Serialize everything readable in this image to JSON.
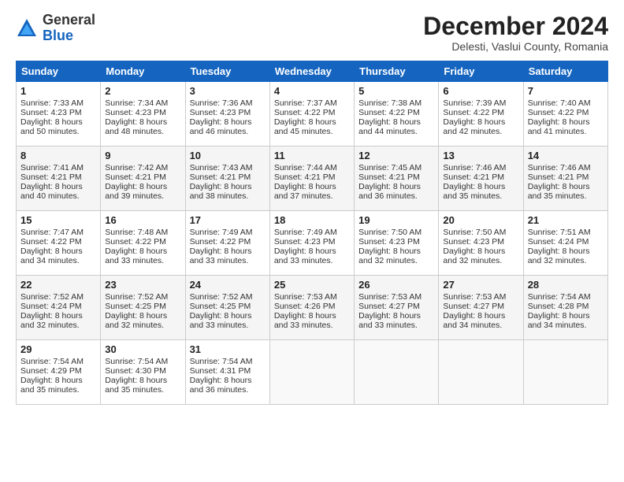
{
  "header": {
    "logo_general": "General",
    "logo_blue": "Blue",
    "month_title": "December 2024",
    "subtitle": "Delesti, Vaslui County, Romania"
  },
  "weekdays": [
    "Sunday",
    "Monday",
    "Tuesday",
    "Wednesday",
    "Thursday",
    "Friday",
    "Saturday"
  ],
  "weeks": [
    [
      {
        "day": "1",
        "sunrise": "7:33 AM",
        "sunset": "4:23 PM",
        "daylight": "8 hours and 50 minutes."
      },
      {
        "day": "2",
        "sunrise": "7:34 AM",
        "sunset": "4:23 PM",
        "daylight": "8 hours and 48 minutes."
      },
      {
        "day": "3",
        "sunrise": "7:36 AM",
        "sunset": "4:23 PM",
        "daylight": "8 hours and 46 minutes."
      },
      {
        "day": "4",
        "sunrise": "7:37 AM",
        "sunset": "4:22 PM",
        "daylight": "8 hours and 45 minutes."
      },
      {
        "day": "5",
        "sunrise": "7:38 AM",
        "sunset": "4:22 PM",
        "daylight": "8 hours and 44 minutes."
      },
      {
        "day": "6",
        "sunrise": "7:39 AM",
        "sunset": "4:22 PM",
        "daylight": "8 hours and 42 minutes."
      },
      {
        "day": "7",
        "sunrise": "7:40 AM",
        "sunset": "4:22 PM",
        "daylight": "8 hours and 41 minutes."
      }
    ],
    [
      {
        "day": "8",
        "sunrise": "7:41 AM",
        "sunset": "4:21 PM",
        "daylight": "8 hours and 40 minutes."
      },
      {
        "day": "9",
        "sunrise": "7:42 AM",
        "sunset": "4:21 PM",
        "daylight": "8 hours and 39 minutes."
      },
      {
        "day": "10",
        "sunrise": "7:43 AM",
        "sunset": "4:21 PM",
        "daylight": "8 hours and 38 minutes."
      },
      {
        "day": "11",
        "sunrise": "7:44 AM",
        "sunset": "4:21 PM",
        "daylight": "8 hours and 37 minutes."
      },
      {
        "day": "12",
        "sunrise": "7:45 AM",
        "sunset": "4:21 PM",
        "daylight": "8 hours and 36 minutes."
      },
      {
        "day": "13",
        "sunrise": "7:46 AM",
        "sunset": "4:21 PM",
        "daylight": "8 hours and 35 minutes."
      },
      {
        "day": "14",
        "sunrise": "7:46 AM",
        "sunset": "4:21 PM",
        "daylight": "8 hours and 35 minutes."
      }
    ],
    [
      {
        "day": "15",
        "sunrise": "7:47 AM",
        "sunset": "4:22 PM",
        "daylight": "8 hours and 34 minutes."
      },
      {
        "day": "16",
        "sunrise": "7:48 AM",
        "sunset": "4:22 PM",
        "daylight": "8 hours and 33 minutes."
      },
      {
        "day": "17",
        "sunrise": "7:49 AM",
        "sunset": "4:22 PM",
        "daylight": "8 hours and 33 minutes."
      },
      {
        "day": "18",
        "sunrise": "7:49 AM",
        "sunset": "4:23 PM",
        "daylight": "8 hours and 33 minutes."
      },
      {
        "day": "19",
        "sunrise": "7:50 AM",
        "sunset": "4:23 PM",
        "daylight": "8 hours and 32 minutes."
      },
      {
        "day": "20",
        "sunrise": "7:50 AM",
        "sunset": "4:23 PM",
        "daylight": "8 hours and 32 minutes."
      },
      {
        "day": "21",
        "sunrise": "7:51 AM",
        "sunset": "4:24 PM",
        "daylight": "8 hours and 32 minutes."
      }
    ],
    [
      {
        "day": "22",
        "sunrise": "7:52 AM",
        "sunset": "4:24 PM",
        "daylight": "8 hours and 32 minutes."
      },
      {
        "day": "23",
        "sunrise": "7:52 AM",
        "sunset": "4:25 PM",
        "daylight": "8 hours and 32 minutes."
      },
      {
        "day": "24",
        "sunrise": "7:52 AM",
        "sunset": "4:25 PM",
        "daylight": "8 hours and 33 minutes."
      },
      {
        "day": "25",
        "sunrise": "7:53 AM",
        "sunset": "4:26 PM",
        "daylight": "8 hours and 33 minutes."
      },
      {
        "day": "26",
        "sunrise": "7:53 AM",
        "sunset": "4:27 PM",
        "daylight": "8 hours and 33 minutes."
      },
      {
        "day": "27",
        "sunrise": "7:53 AM",
        "sunset": "4:27 PM",
        "daylight": "8 hours and 34 minutes."
      },
      {
        "day": "28",
        "sunrise": "7:54 AM",
        "sunset": "4:28 PM",
        "daylight": "8 hours and 34 minutes."
      }
    ],
    [
      {
        "day": "29",
        "sunrise": "7:54 AM",
        "sunset": "4:29 PM",
        "daylight": "8 hours and 35 minutes."
      },
      {
        "day": "30",
        "sunrise": "7:54 AM",
        "sunset": "4:30 PM",
        "daylight": "8 hours and 35 minutes."
      },
      {
        "day": "31",
        "sunrise": "7:54 AM",
        "sunset": "4:31 PM",
        "daylight": "8 hours and 36 minutes."
      },
      null,
      null,
      null,
      null
    ]
  ]
}
